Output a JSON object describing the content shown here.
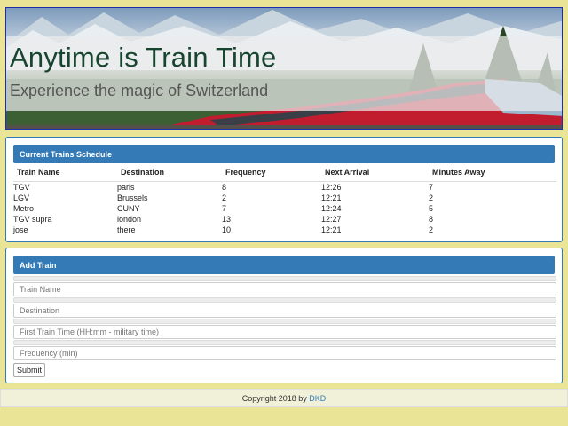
{
  "header": {
    "title": "Anytime is Train Time",
    "subtitle": "Experience the magic of Switzerland"
  },
  "schedule": {
    "heading": "Current Trains Schedule",
    "columns": [
      "Train Name",
      "Destination",
      "Frequency",
      "Next Arrival",
      "Minutes Away"
    ],
    "rows": [
      [
        "TGV",
        "paris",
        "8",
        "12:26",
        "7"
      ],
      [
        "LGV",
        "Brussels",
        "2",
        "12:21",
        "2"
      ],
      [
        "Metro",
        "CUNY",
        "7",
        "12:24",
        "5"
      ],
      [
        "TGV supra",
        "london",
        "13",
        "12:27",
        "8"
      ],
      [
        "jose",
        "there",
        "10",
        "12:21",
        "2"
      ]
    ]
  },
  "add_train": {
    "heading": "Add Train",
    "fields": {
      "train_name": "Train Name",
      "destination": "Destination",
      "first_time": "First Train Time (HH:mm - military time)",
      "frequency": "Frequency (min)"
    },
    "submit_label": "Submit"
  },
  "footer": {
    "copyright": "Copyright 2018 by",
    "author": "DKD"
  },
  "colors": {
    "page_bg": "#eae596",
    "panel_accent": "#337ab7",
    "title_text": "#17452f"
  }
}
